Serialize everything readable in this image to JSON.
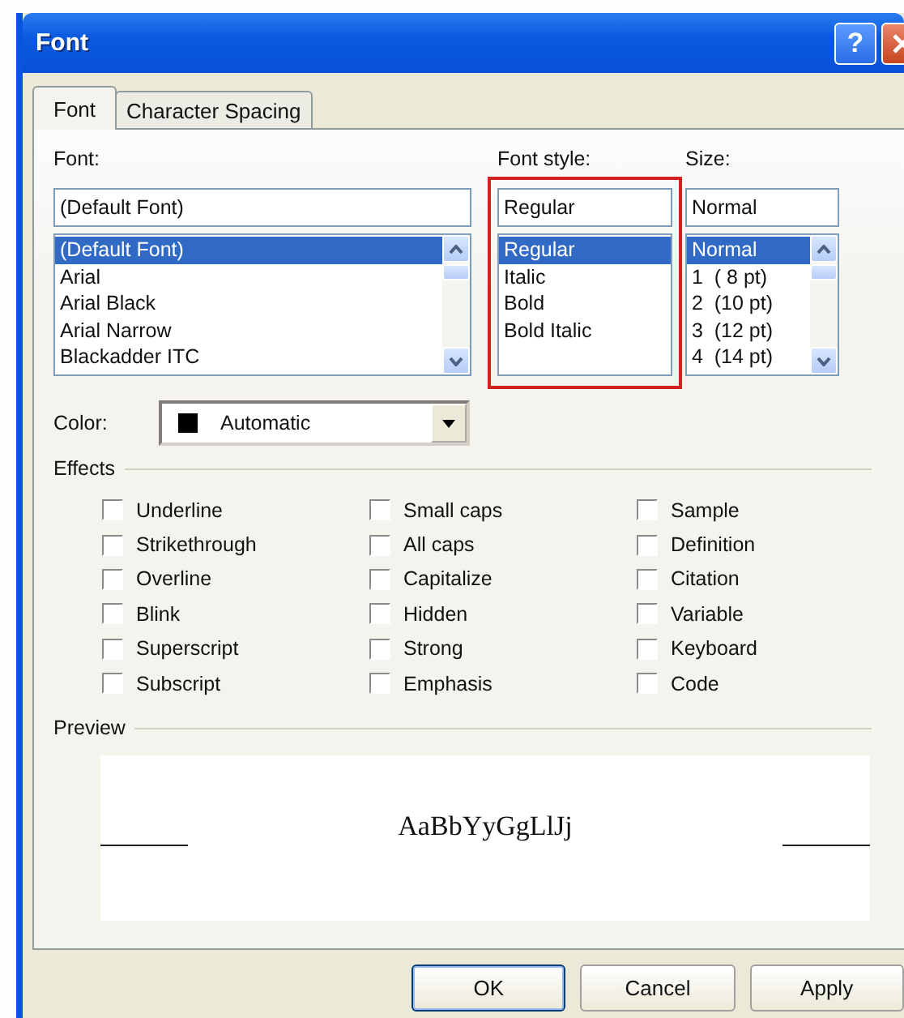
{
  "window": {
    "title": "Font",
    "help_button": "?"
  },
  "tabs": [
    {
      "label": "Font",
      "selected": true
    },
    {
      "label": "Character Spacing",
      "selected": false
    }
  ],
  "pickers": [
    {
      "label": "Font:",
      "value": "(Default Font)",
      "highlighted": false,
      "scrollbar": true,
      "items": [
        {
          "label": "(Default Font)",
          "selected": true
        },
        {
          "label": "Arial",
          "selected": false
        },
        {
          "label": "Arial Black",
          "selected": false
        },
        {
          "label": "Arial Narrow",
          "selected": false
        },
        {
          "label": "Blackadder ITC",
          "selected": false
        }
      ]
    },
    {
      "label": "Font style:",
      "value": "Regular",
      "highlighted": true,
      "scrollbar": false,
      "items": [
        {
          "label": "Regular",
          "selected": true
        },
        {
          "label": "Italic",
          "selected": false
        },
        {
          "label": "Bold",
          "selected": false
        },
        {
          "label": "Bold Italic",
          "selected": false
        }
      ]
    },
    {
      "label": "Size:",
      "value": "Normal",
      "highlighted": false,
      "scrollbar": true,
      "items": [
        {
          "label": "Normal",
          "selected": true
        },
        {
          "label": "1  ( 8 pt)",
          "selected": false
        },
        {
          "label": "2  (10 pt)",
          "selected": false
        },
        {
          "label": "3  (12 pt)",
          "selected": false
        },
        {
          "label": "4  (14 pt)",
          "selected": false
        }
      ]
    }
  ],
  "color": {
    "label": "Color:",
    "value": "Automatic"
  },
  "effects": {
    "title": "Effects",
    "columns": [
      [
        {
          "label": "Underline",
          "checked": false
        },
        {
          "label": "Strikethrough",
          "checked": false
        },
        {
          "label": "Overline",
          "checked": false
        },
        {
          "label": "Blink",
          "checked": false
        },
        {
          "label": "Superscript",
          "checked": false
        },
        {
          "label": "Subscript",
          "checked": false
        }
      ],
      [
        {
          "label": "Small caps",
          "checked": false
        },
        {
          "label": "All caps",
          "checked": false
        },
        {
          "label": "Capitalize",
          "checked": false
        },
        {
          "label": "Hidden",
          "checked": false
        },
        {
          "label": "Strong",
          "checked": false
        },
        {
          "label": "Emphasis",
          "checked": false
        }
      ],
      [
        {
          "label": "Sample",
          "checked": false
        },
        {
          "label": "Definition",
          "checked": false
        },
        {
          "label": "Citation",
          "checked": false
        },
        {
          "label": "Variable",
          "checked": false
        },
        {
          "label": "Keyboard",
          "checked": false
        },
        {
          "label": "Code",
          "checked": false
        }
      ]
    ]
  },
  "preview": {
    "title": "Preview",
    "sample": "AaBbYyGgLlJj"
  },
  "buttons": [
    {
      "label": "OK",
      "default": true
    },
    {
      "label": "Cancel",
      "default": false
    },
    {
      "label": "Apply",
      "default": false
    }
  ]
}
